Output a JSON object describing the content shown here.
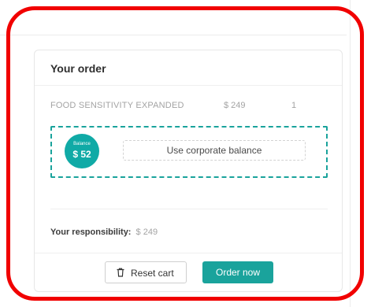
{
  "order_card": {
    "title": "Your order",
    "items": [
      {
        "name": "FOOD SENSITIVITY EXPANDED",
        "price": "$ 249",
        "quantity": "1"
      }
    ],
    "balance": {
      "caption": "Balance",
      "amount": "$ 52",
      "button_label": "Use corporate balance"
    },
    "responsibility": {
      "label": "Your responsibility:",
      "amount": "$ 249"
    },
    "actions": {
      "reset_label": "Reset cart",
      "order_label": "Order now"
    }
  },
  "colors": {
    "accent": "#1aa39c",
    "highlight": "#f10000",
    "muted_text": "#a3a3a3"
  },
  "icons": {
    "reset": "trash-icon"
  }
}
